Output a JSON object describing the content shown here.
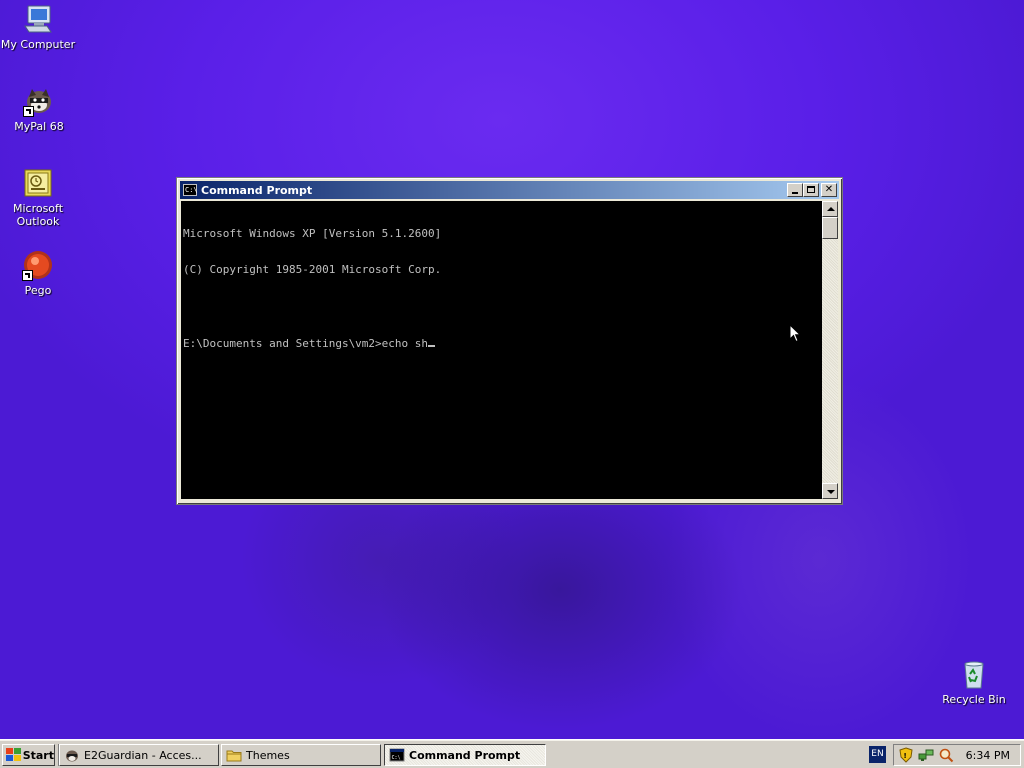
{
  "desktop": {
    "icons": [
      {
        "label": "My Computer",
        "icon": "my-computer-icon"
      },
      {
        "label": "MyPal 68",
        "icon": "mypal-icon"
      },
      {
        "label": "Microsoft\nOutlook",
        "label_line1": "Microsoft",
        "label_line2": "Outlook",
        "icon": "outlook-icon"
      },
      {
        "label": "Pego",
        "icon": "pego-icon"
      },
      {
        "label": "Recycle Bin",
        "icon": "recycle-bin-icon"
      }
    ],
    "wallpaper_color": "#5a1fe8"
  },
  "cmd_window": {
    "title": "Command Prompt",
    "lines": [
      "Microsoft Windows XP [Version 5.1.2600]",
      "(C) Copyright 1985-2001 Microsoft Corp.",
      "",
      "E:\\Documents and Settings\\vm2>echo sh"
    ],
    "background": "#000000",
    "text_color": "#c0c0c0",
    "title_gradient": [
      "#0a246a",
      "#a6caf0"
    ]
  },
  "taskbar": {
    "start_label": "Start",
    "tasks": [
      {
        "label": "E2Guardian - Acces...",
        "icon": "mypal-icon",
        "active": false
      },
      {
        "label": "Themes",
        "icon": "folder-icon",
        "active": false
      },
      {
        "label": "Command Prompt",
        "icon": "cmd-icon",
        "active": true
      }
    ],
    "language": "EN",
    "clock": "6:34 PM"
  }
}
